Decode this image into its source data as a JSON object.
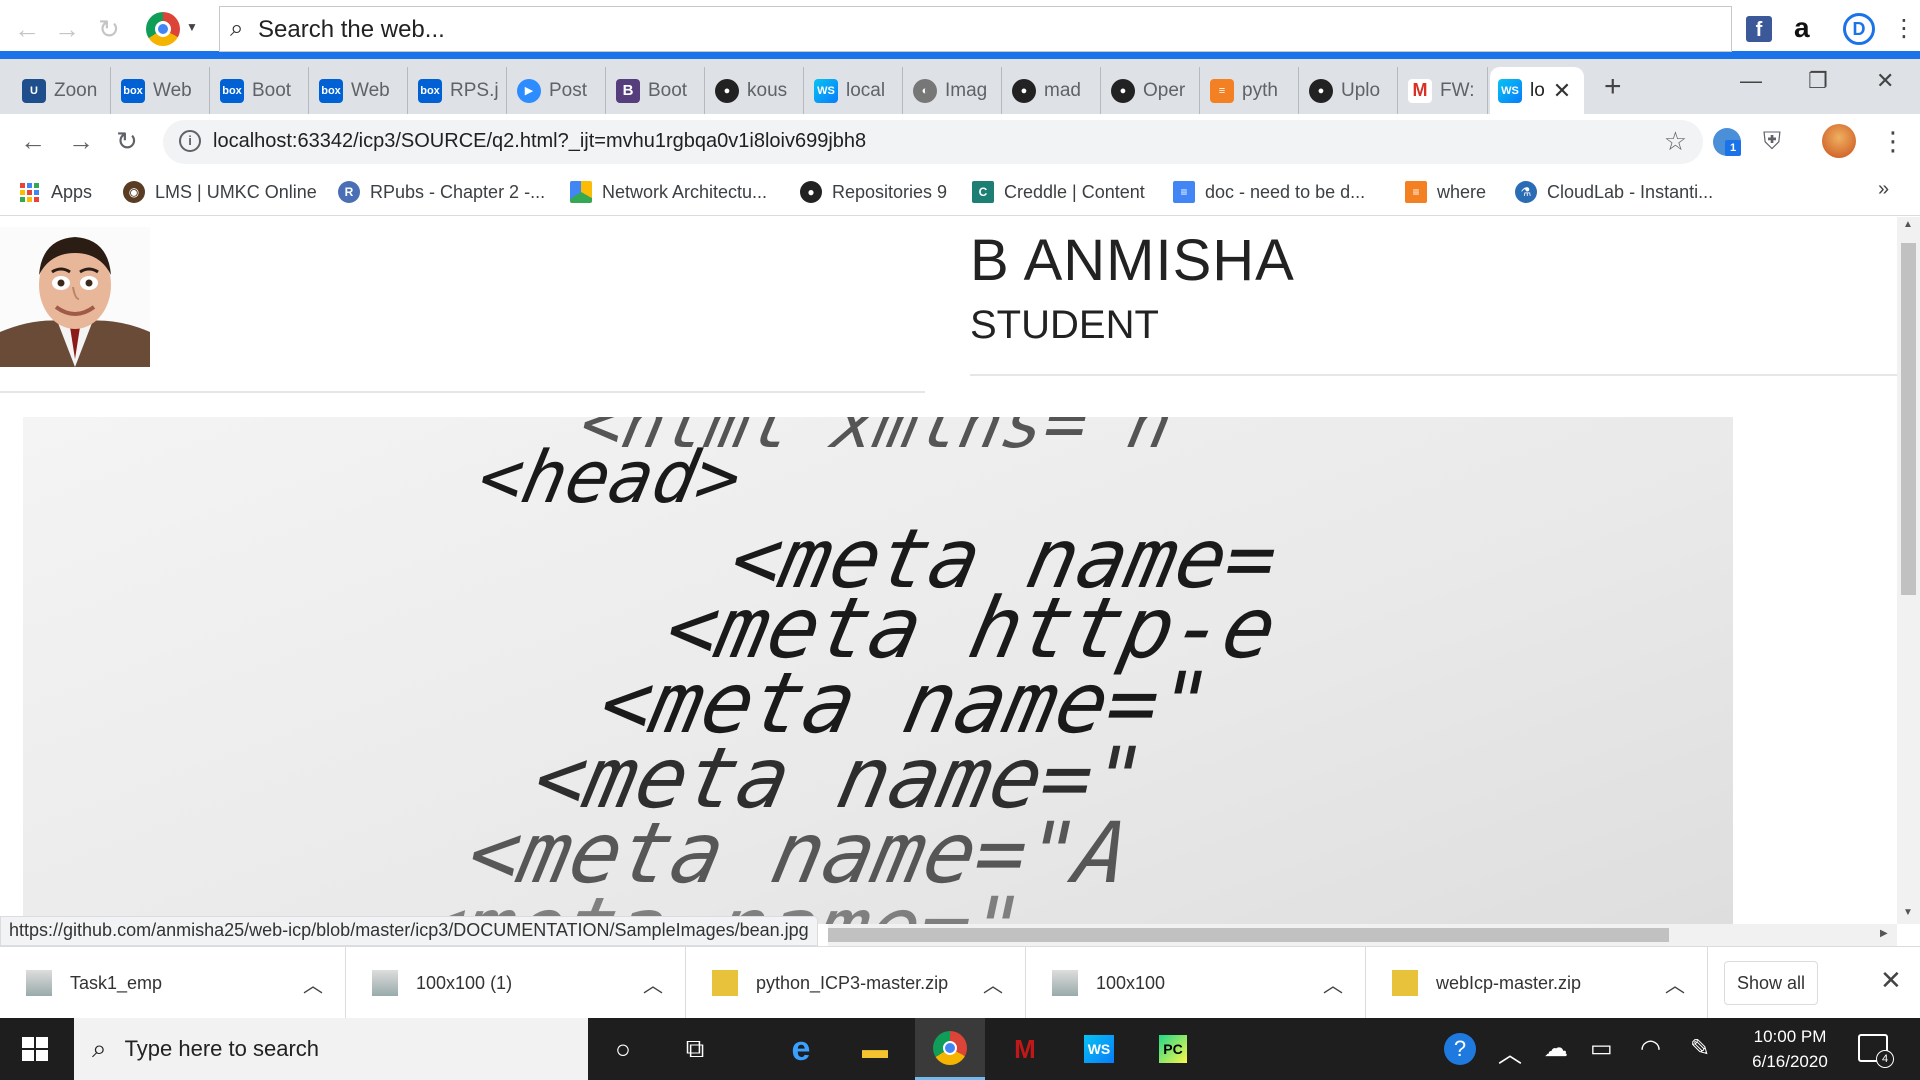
{
  "search": {
    "placeholder": "Search the web..."
  },
  "tabs": [
    {
      "label": "Zoon",
      "icon": "umkc-icon"
    },
    {
      "label": "Web",
      "icon": "box-icon"
    },
    {
      "label": "Boot",
      "icon": "box-icon"
    },
    {
      "label": "Web",
      "icon": "box-icon"
    },
    {
      "label": "RPS.j",
      "icon": "box-icon"
    },
    {
      "label": "Post",
      "icon": "zoom-icon"
    },
    {
      "label": "Boot",
      "icon": "bootstrap-icon"
    },
    {
      "label": "kous",
      "icon": "github-icon"
    },
    {
      "label": "local",
      "icon": "webstorm-icon"
    },
    {
      "label": "Imag",
      "icon": "globe-icon"
    },
    {
      "label": "mad",
      "icon": "github-icon"
    },
    {
      "label": "Oper",
      "icon": "github-icon"
    },
    {
      "label": "pyth",
      "icon": "stackoverflow-icon"
    },
    {
      "label": "Uplo",
      "icon": "github-icon"
    },
    {
      "label": "FW:",
      "icon": "gmail-icon"
    },
    {
      "label": "lo",
      "icon": "webstorm-icon"
    }
  ],
  "address": {
    "url": "localhost:63342/icp3/SOURCE/q2.html?_ijt=mvhu1rgbqa0v1i8loiv699jbh8"
  },
  "bookmarks": [
    {
      "label": "Apps"
    },
    {
      "label": "LMS | UMKC Online"
    },
    {
      "label": "RPubs - Chapter 2 -..."
    },
    {
      "label": "Network Architectu..."
    },
    {
      "label": "Repositories 9"
    },
    {
      "label": "Creddle | Content"
    },
    {
      "label": "doc - need to be d..."
    },
    {
      "label": "where"
    },
    {
      "label": "CloudLab - Instanti..."
    }
  ],
  "page": {
    "name": "B ANMISHA",
    "role": "STUDENT",
    "code_lines": [
      "<html xmlns=\"h",
      "<head>",
      "<meta name=",
      "<meta http-e",
      "<meta name=\"",
      "<meta name=\"",
      "<meta name=\"A",
      "<meta name=\""
    ]
  },
  "status_url": "https://github.com/anmisha25/web-icp/blob/master/icp3/DOCUMENTATION/SampleImages/bean.jpg",
  "downloads": [
    {
      "label": "Task1_emp"
    },
    {
      "label": "100x100 (1)"
    },
    {
      "label": "python_ICP3-master.zip"
    },
    {
      "label": "100x100"
    },
    {
      "label": "webIcp-master.zip"
    }
  ],
  "downloads_show_all": "Show all",
  "taskbar": {
    "search_placeholder": "Type here to search",
    "time": "10:00 PM",
    "date": "6/16/2020",
    "notifications": "4"
  }
}
